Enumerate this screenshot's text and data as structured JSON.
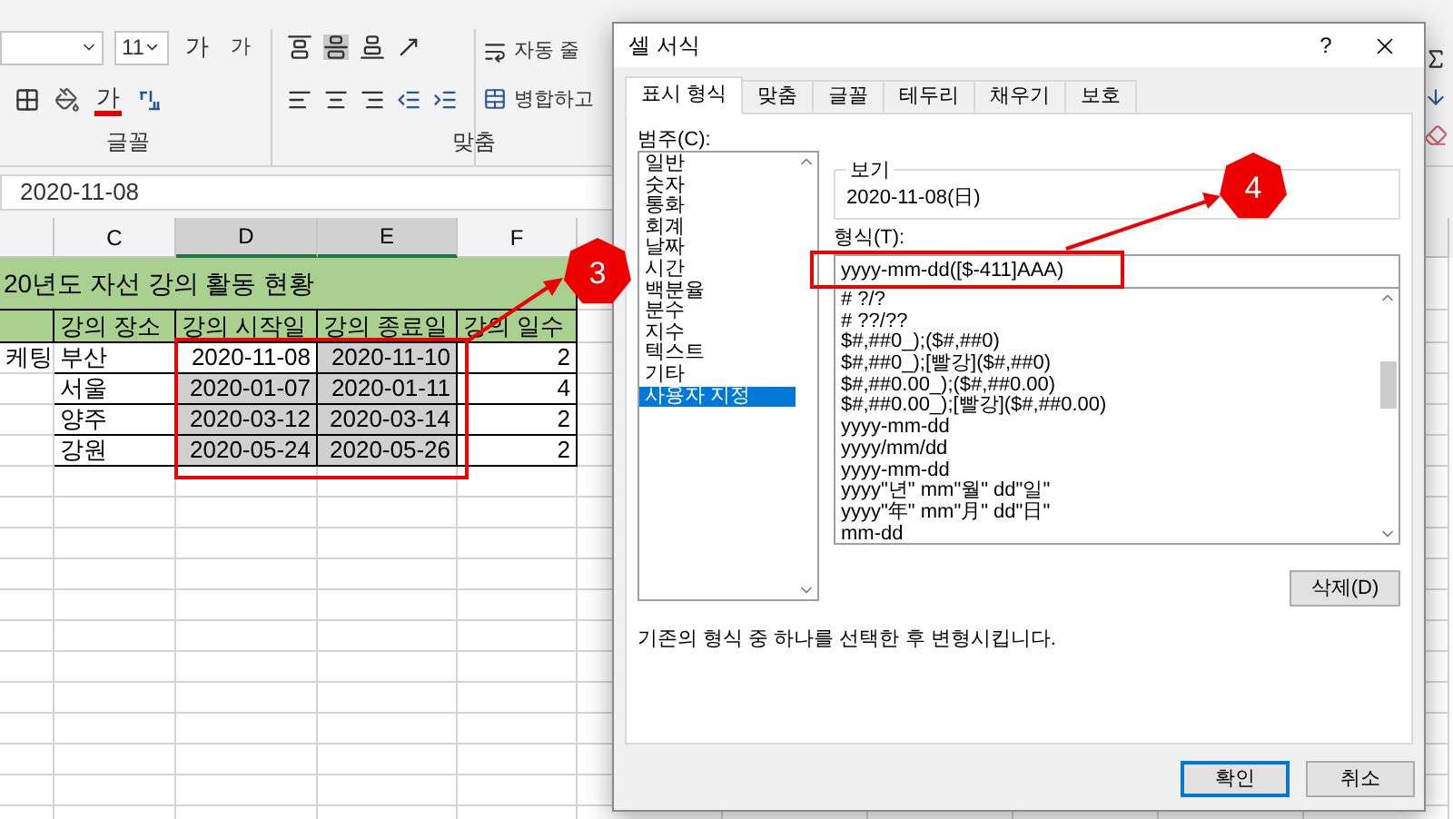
{
  "ribbon": {
    "font_size": "11",
    "grow_font": "가",
    "shrink_font": "가",
    "font_color": "가",
    "groups": [
      "글꼴",
      "맞춤"
    ],
    "wrap_text": "자동 줄",
    "merge": "병합하고"
  },
  "formula_bar": {
    "value": "2020-11-08"
  },
  "sheet": {
    "columns": [
      {
        "label": "C",
        "selected": false
      },
      {
        "label": "D",
        "selected": true
      },
      {
        "label": "E",
        "selected": true
      },
      {
        "label": "F",
        "selected": false
      }
    ],
    "title": "20년도 자선 강의 활동 현황",
    "header": [
      "강의 장소",
      "강의 시작일",
      "강의 종료일",
      "강의 일수"
    ],
    "rows": [
      {
        "lead": "케팅",
        "cells": [
          {
            "text": "부산",
            "selected": false
          },
          {
            "text": "2020-11-08",
            "selected": false
          },
          {
            "text": "2020-11-10",
            "selected": true
          },
          {
            "text": "2",
            "selected": false
          }
        ]
      },
      {
        "cells": [
          {
            "text": "서울",
            "selected": false
          },
          {
            "text": "2020-01-07",
            "selected": true
          },
          {
            "text": "2020-01-11",
            "selected": true
          },
          {
            "text": "4",
            "selected": false
          }
        ]
      },
      {
        "cells": [
          {
            "text": "양주",
            "selected": false
          },
          {
            "text": "2020-03-12",
            "selected": true
          },
          {
            "text": "2020-03-14",
            "selected": true
          },
          {
            "text": "2",
            "selected": false
          }
        ]
      },
      {
        "cells": [
          {
            "text": "강원",
            "selected": false
          },
          {
            "text": "2020-05-24",
            "selected": true
          },
          {
            "text": "2020-05-26",
            "selected": true
          },
          {
            "text": "2",
            "selected": false
          }
        ]
      }
    ]
  },
  "dialog": {
    "title": "셀 서식",
    "help": "?",
    "tabs": [
      {
        "label": "표시 형식",
        "selected": true
      },
      {
        "label": "맞춤",
        "selected": false
      },
      {
        "label": "글꼴",
        "selected": false
      },
      {
        "label": "테두리",
        "selected": false
      },
      {
        "label": "채우기",
        "selected": false
      },
      {
        "label": "보호",
        "selected": false
      }
    ],
    "category_label": "범주(C):",
    "categories": [
      {
        "label": "일반",
        "selected": false
      },
      {
        "label": "숫자",
        "selected": false
      },
      {
        "label": "통화",
        "selected": false
      },
      {
        "label": "회계",
        "selected": false
      },
      {
        "label": "날짜",
        "selected": false
      },
      {
        "label": "시간",
        "selected": false
      },
      {
        "label": "백분율",
        "selected": false
      },
      {
        "label": "분수",
        "selected": false
      },
      {
        "label": "지수",
        "selected": false
      },
      {
        "label": "텍스트",
        "selected": false
      },
      {
        "label": "기타",
        "selected": false
      },
      {
        "label": "사용자 지정",
        "selected": true
      }
    ],
    "preview_label": "보기",
    "preview": "2020-11-08(日)",
    "format_label": "형식(T):",
    "format_value": "yyyy-mm-dd([$-411]AAA)",
    "formats": [
      "# ?/?",
      "# ??/??",
      "$#,##0_);($#,##0)",
      "$#,##0_);[빨강]($#,##0)",
      "$#,##0.00_);($#,##0.00)",
      "$#,##0.00_);[빨강]($#,##0.00)",
      "yyyy-mm-dd",
      "yyyy/mm/dd",
      "yyyy-mm-dd",
      "yyyy\"년\" mm\"월\" dd\"일\"",
      "yyyy\"年\" mm\"月\" dd\"日\"",
      "mm-dd"
    ],
    "delete_button": "삭제(D)",
    "description": "기존의 형식 중 하나를 선택한 후 변형시킵니다.",
    "buttons": [
      {
        "label": "확인",
        "kind": "default"
      },
      {
        "label": "취소",
        "kind": "normal"
      }
    ]
  },
  "annotations": {
    "badges": [
      "3",
      "4"
    ]
  }
}
